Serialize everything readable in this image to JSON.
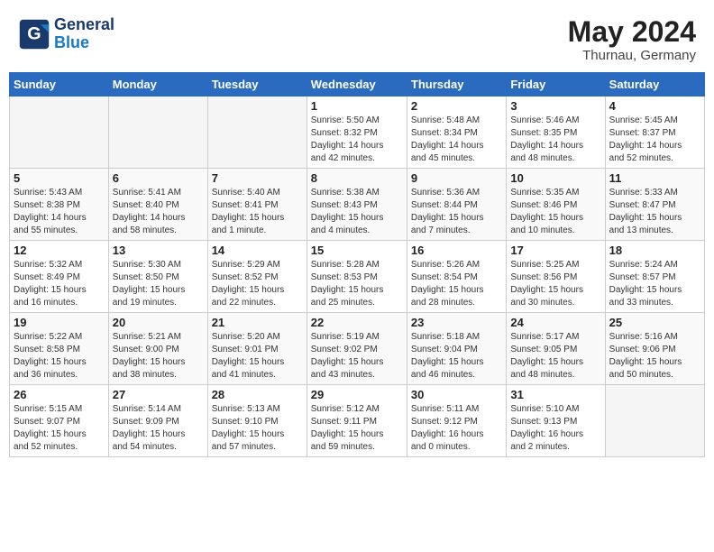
{
  "header": {
    "logo_general": "General",
    "logo_blue": "Blue",
    "month_year": "May 2024",
    "location": "Thurnau, Germany"
  },
  "weekdays": [
    "Sunday",
    "Monday",
    "Tuesday",
    "Wednesday",
    "Thursday",
    "Friday",
    "Saturday"
  ],
  "weeks": [
    [
      {
        "day": "",
        "info": ""
      },
      {
        "day": "",
        "info": ""
      },
      {
        "day": "",
        "info": ""
      },
      {
        "day": "1",
        "info": "Sunrise: 5:50 AM\nSunset: 8:32 PM\nDaylight: 14 hours\nand 42 minutes."
      },
      {
        "day": "2",
        "info": "Sunrise: 5:48 AM\nSunset: 8:34 PM\nDaylight: 14 hours\nand 45 minutes."
      },
      {
        "day": "3",
        "info": "Sunrise: 5:46 AM\nSunset: 8:35 PM\nDaylight: 14 hours\nand 48 minutes."
      },
      {
        "day": "4",
        "info": "Sunrise: 5:45 AM\nSunset: 8:37 PM\nDaylight: 14 hours\nand 52 minutes."
      }
    ],
    [
      {
        "day": "5",
        "info": "Sunrise: 5:43 AM\nSunset: 8:38 PM\nDaylight: 14 hours\nand 55 minutes."
      },
      {
        "day": "6",
        "info": "Sunrise: 5:41 AM\nSunset: 8:40 PM\nDaylight: 14 hours\nand 58 minutes."
      },
      {
        "day": "7",
        "info": "Sunrise: 5:40 AM\nSunset: 8:41 PM\nDaylight: 15 hours\nand 1 minute."
      },
      {
        "day": "8",
        "info": "Sunrise: 5:38 AM\nSunset: 8:43 PM\nDaylight: 15 hours\nand 4 minutes."
      },
      {
        "day": "9",
        "info": "Sunrise: 5:36 AM\nSunset: 8:44 PM\nDaylight: 15 hours\nand 7 minutes."
      },
      {
        "day": "10",
        "info": "Sunrise: 5:35 AM\nSunset: 8:46 PM\nDaylight: 15 hours\nand 10 minutes."
      },
      {
        "day": "11",
        "info": "Sunrise: 5:33 AM\nSunset: 8:47 PM\nDaylight: 15 hours\nand 13 minutes."
      }
    ],
    [
      {
        "day": "12",
        "info": "Sunrise: 5:32 AM\nSunset: 8:49 PM\nDaylight: 15 hours\nand 16 minutes."
      },
      {
        "day": "13",
        "info": "Sunrise: 5:30 AM\nSunset: 8:50 PM\nDaylight: 15 hours\nand 19 minutes."
      },
      {
        "day": "14",
        "info": "Sunrise: 5:29 AM\nSunset: 8:52 PM\nDaylight: 15 hours\nand 22 minutes."
      },
      {
        "day": "15",
        "info": "Sunrise: 5:28 AM\nSunset: 8:53 PM\nDaylight: 15 hours\nand 25 minutes."
      },
      {
        "day": "16",
        "info": "Sunrise: 5:26 AM\nSunset: 8:54 PM\nDaylight: 15 hours\nand 28 minutes."
      },
      {
        "day": "17",
        "info": "Sunrise: 5:25 AM\nSunset: 8:56 PM\nDaylight: 15 hours\nand 30 minutes."
      },
      {
        "day": "18",
        "info": "Sunrise: 5:24 AM\nSunset: 8:57 PM\nDaylight: 15 hours\nand 33 minutes."
      }
    ],
    [
      {
        "day": "19",
        "info": "Sunrise: 5:22 AM\nSunset: 8:58 PM\nDaylight: 15 hours\nand 36 minutes."
      },
      {
        "day": "20",
        "info": "Sunrise: 5:21 AM\nSunset: 9:00 PM\nDaylight: 15 hours\nand 38 minutes."
      },
      {
        "day": "21",
        "info": "Sunrise: 5:20 AM\nSunset: 9:01 PM\nDaylight: 15 hours\nand 41 minutes."
      },
      {
        "day": "22",
        "info": "Sunrise: 5:19 AM\nSunset: 9:02 PM\nDaylight: 15 hours\nand 43 minutes."
      },
      {
        "day": "23",
        "info": "Sunrise: 5:18 AM\nSunset: 9:04 PM\nDaylight: 15 hours\nand 46 minutes."
      },
      {
        "day": "24",
        "info": "Sunrise: 5:17 AM\nSunset: 9:05 PM\nDaylight: 15 hours\nand 48 minutes."
      },
      {
        "day": "25",
        "info": "Sunrise: 5:16 AM\nSunset: 9:06 PM\nDaylight: 15 hours\nand 50 minutes."
      }
    ],
    [
      {
        "day": "26",
        "info": "Sunrise: 5:15 AM\nSunset: 9:07 PM\nDaylight: 15 hours\nand 52 minutes."
      },
      {
        "day": "27",
        "info": "Sunrise: 5:14 AM\nSunset: 9:09 PM\nDaylight: 15 hours\nand 54 minutes."
      },
      {
        "day": "28",
        "info": "Sunrise: 5:13 AM\nSunset: 9:10 PM\nDaylight: 15 hours\nand 57 minutes."
      },
      {
        "day": "29",
        "info": "Sunrise: 5:12 AM\nSunset: 9:11 PM\nDaylight: 15 hours\nand 59 minutes."
      },
      {
        "day": "30",
        "info": "Sunrise: 5:11 AM\nSunset: 9:12 PM\nDaylight: 16 hours\nand 0 minutes."
      },
      {
        "day": "31",
        "info": "Sunrise: 5:10 AM\nSunset: 9:13 PM\nDaylight: 16 hours\nand 2 minutes."
      },
      {
        "day": "",
        "info": ""
      }
    ]
  ]
}
